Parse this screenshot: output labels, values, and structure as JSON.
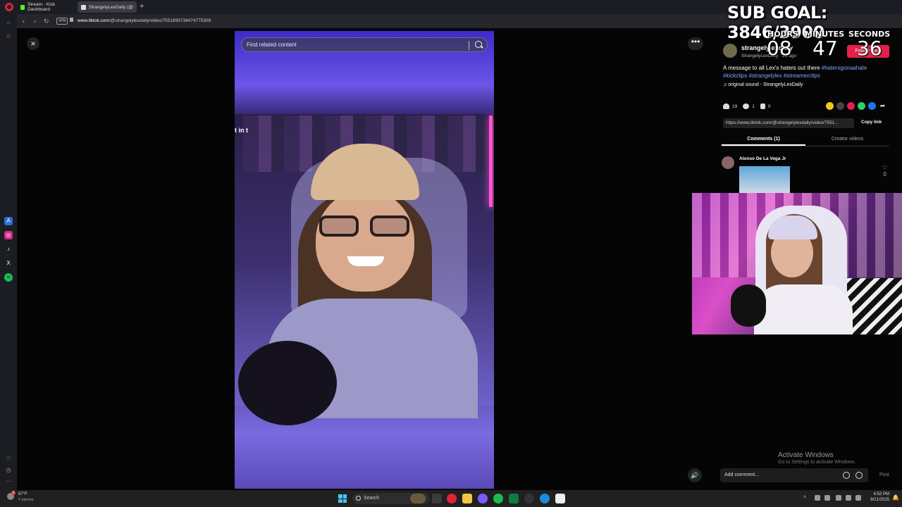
{
  "browser": {
    "tabs": [
      {
        "label": "Stream - Kick Dashboard",
        "color": "#53fc18"
      },
      {
        "label": "StrangelyLexDaily (@",
        "color": "#dddddd"
      }
    ],
    "new_tab": "+",
    "nav": {
      "back": "‹",
      "forward": "›",
      "reload": "↻"
    },
    "vpn_label": "VPN",
    "url_host": "www.tiktok.com",
    "url_path": "/@strangelylexdaily/video/7551899739474775309"
  },
  "overlay": {
    "sub_goal": "SUB GOAL: 3846/3900",
    "timer": {
      "hours_label": "HOURS",
      "hours": "08",
      "minutes_label": "MINUTES",
      "minutes": "47",
      "seconds_label": "SECONDS",
      "seconds": "36"
    }
  },
  "video": {
    "search_placeholder": "Find related content",
    "snippet_text": "t in t",
    "close_icon": "×",
    "more_icon": "•••"
  },
  "post": {
    "author": "strangelylexdaily",
    "author_sub": "StrangelyLexDaily · 2d ago",
    "follow_label": "Follow back",
    "caption_text": "A message to all Lex's haters out there ",
    "hashtags": [
      "#hatersgonaahate",
      "#kickclips",
      "#strangelylex",
      "#streamerclips"
    ],
    "sound": "original sound - StrangelyLexDaily",
    "likes": "19",
    "comments_count": "1",
    "saves": "0",
    "link": "https://www.tiktok.com/@strangelylexdaily/video/7551...",
    "copy_link_label": "Copy link",
    "tab_comments": "Comments (1)",
    "tab_creator": "Creator videos",
    "share_colors": [
      "#f2c81a",
      "#444444",
      "#e6204c",
      "#25d366",
      "#1877f2"
    ]
  },
  "comment": {
    "author": "Alonso De La Vega Jr",
    "likes": "0"
  },
  "footer": {
    "activate_title": "Activate Windows",
    "activate_sub": "Go to Settings to activate Windows.",
    "add_comment_placeholder": "Add comment...",
    "post_label": "Post"
  },
  "taskbar": {
    "weather_badge": "3",
    "temp": "87°F",
    "condition": "T-storms",
    "search_label": "Search",
    "time": "4:52 PM",
    "date": "9/21/2025"
  }
}
